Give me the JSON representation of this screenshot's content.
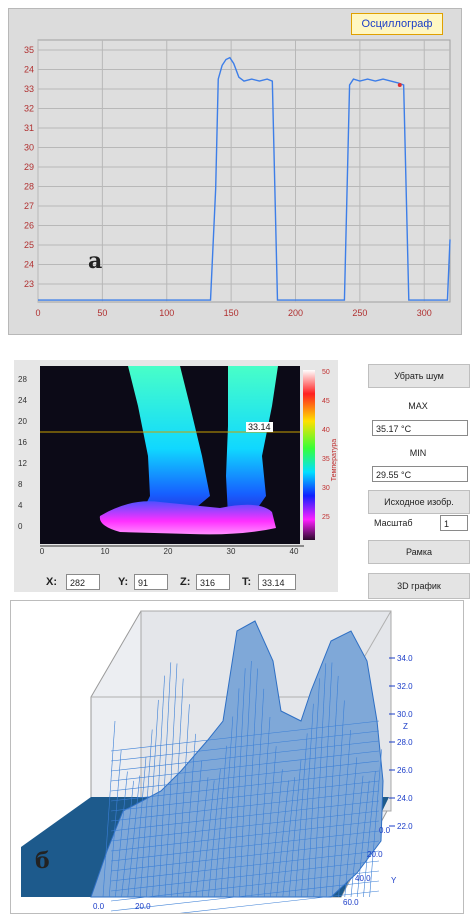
{
  "oscilloscope": {
    "button_label": "Осциллограф",
    "panel_label": "а",
    "line_color": "#3d7ee8",
    "chart_data": {
      "type": "line",
      "title": "",
      "xlabel": "",
      "ylabel": "",
      "xlim": [
        0,
        320
      ],
      "ylim": [
        22.2,
        35.6
      ],
      "x_ticks": [
        0,
        50,
        100,
        150,
        200,
        250,
        300
      ],
      "y_ticks": [
        "35",
        "24",
        "33",
        "32",
        "31",
        "30",
        "29",
        "28",
        "27",
        "26",
        "25",
        "24",
        "23"
      ],
      "grid": true,
      "series": [
        {
          "x": [
            0,
            134,
            138,
            140,
            143,
            146,
            149,
            152,
            156,
            160,
            166,
            172,
            178,
            182,
            186,
            190,
            220,
            238,
            242,
            245,
            250,
            256,
            262,
            268,
            274,
            280,
            284,
            288,
            318,
            320
          ],
          "y": [
            22.3,
            22.3,
            28.0,
            33.6,
            34.3,
            34.6,
            34.7,
            34.4,
            33.7,
            33.5,
            33.6,
            33.5,
            33.6,
            33.5,
            22.3,
            22.3,
            22.3,
            22.3,
            33.3,
            33.6,
            33.5,
            33.6,
            33.5,
            33.6,
            33.5,
            33.4,
            33.3,
            22.3,
            22.3,
            25.4
          ],
          "marker": {
            "x": 281,
            "y": 33.3,
            "color": "#e03030"
          }
        }
      ]
    }
  },
  "thermogram": {
    "y_ticks": [
      "28",
      "24",
      "20",
      "16",
      "12",
      "8",
      "4",
      "0"
    ],
    "x_ticks": [
      "0",
      "10",
      "20",
      "30",
      "40"
    ],
    "colorbar_ticks": [
      "50",
      "45",
      "40",
      "35",
      "30",
      "25"
    ],
    "colorbar_title": "Температура",
    "cursor_value": "33.14",
    "coords": {
      "x_label": "X:",
      "x_value": "282",
      "y_label": "Y:",
      "y_value": "91",
      "z_label": "Z:",
      "z_value": "316",
      "t_label": "T:",
      "t_value": "33.14"
    }
  },
  "controls": {
    "remove_noise": "Убрать шум",
    "max_label": "MAX",
    "max_value": "35.17 °C",
    "min_label": "MIN",
    "min_value": "29.55 °C",
    "source_image": "Исходное изобр.",
    "scale_label": "Масштаб",
    "scale_value": "1",
    "frame": "Рамка",
    "graph_3d": "3D график"
  },
  "surface3d": {
    "panel_label": "б",
    "z_ticks": [
      "34.0",
      "32.0",
      "30.0",
      "28.0",
      "26.0",
      "24.0",
      "22.0"
    ],
    "y_ticks": [
      "0.0",
      "20.0",
      "40.0",
      "60.0"
    ],
    "y_axis_label": "Y",
    "z_axis_label": "Z",
    "x_ticks": [
      "0.0",
      "20.0"
    ],
    "mesh_color": "#3b7fd6"
  }
}
